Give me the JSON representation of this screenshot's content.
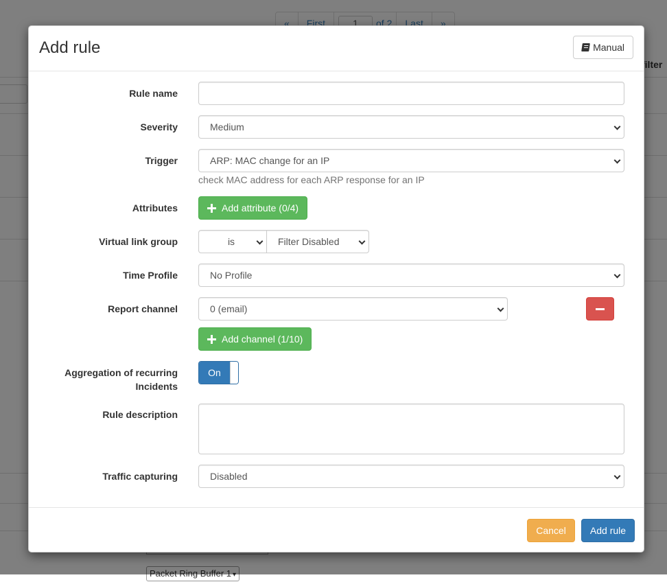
{
  "background": {
    "pager": {
      "first_arrow": "«",
      "first": "First",
      "page": "1",
      "of": "of 2",
      "last": "Last",
      "last_arrow": "»"
    },
    "column_header": "filter",
    "select_value": "Packet Ring Buffer 1"
  },
  "modal": {
    "title": "Add rule",
    "manual_label": "Manual",
    "fields": {
      "rule_name": {
        "label": "Rule name",
        "value": ""
      },
      "severity": {
        "label": "Severity",
        "value": "Medium"
      },
      "trigger": {
        "label": "Trigger",
        "value": "ARP: MAC change for an IP",
        "help": "check MAC address for each ARP response for an IP"
      },
      "attributes": {
        "label": "Attributes",
        "button": "Add attribute (0/4)"
      },
      "virtual_link_group": {
        "label": "Virtual link group",
        "operator": "is",
        "value": "Filter Disabled"
      },
      "time_profile": {
        "label": "Time Profile",
        "value": "No Profile"
      },
      "report_channel": {
        "label": "Report channel",
        "value": "0 (email)",
        "add_button": "Add channel (1/10)"
      },
      "aggregation": {
        "label_line1": "Aggregation of recurring",
        "label_line2": "Incidents",
        "toggle": "On"
      },
      "rule_description": {
        "label": "Rule description",
        "value": ""
      },
      "traffic_capturing": {
        "label": "Traffic capturing",
        "value": "Disabled"
      }
    },
    "footer": {
      "cancel": "Cancel",
      "submit": "Add rule"
    }
  },
  "colors": {
    "success": "#5cb85c",
    "danger": "#d9534f",
    "warning": "#f0ad4e",
    "primary": "#337ab7"
  }
}
